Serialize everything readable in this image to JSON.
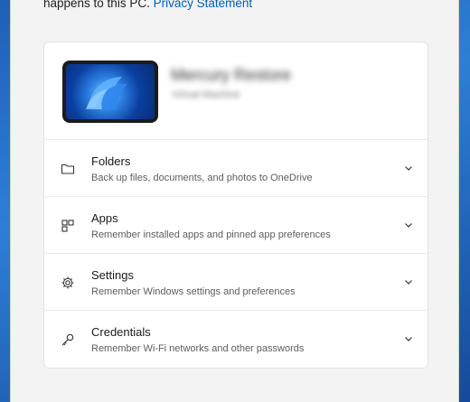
{
  "intro": {
    "text": "happens to this PC.",
    "link": "Privacy Statement"
  },
  "device": {
    "name": "Mercury Restore",
    "subtitle": "Virtual Machine"
  },
  "rows": [
    {
      "icon": "folder-icon",
      "title": "Folders",
      "desc": "Back up files, documents, and photos to OneDrive"
    },
    {
      "icon": "apps-icon",
      "title": "Apps",
      "desc": "Remember installed apps and pinned app preferences"
    },
    {
      "icon": "gear-icon",
      "title": "Settings",
      "desc": "Remember Windows settings and preferences"
    },
    {
      "icon": "key-icon",
      "title": "Credentials",
      "desc": "Remember Wi-Fi networks and other passwords"
    }
  ],
  "colors": {
    "accent": "#005fb8",
    "wallpaper": "#1f5fb8"
  }
}
